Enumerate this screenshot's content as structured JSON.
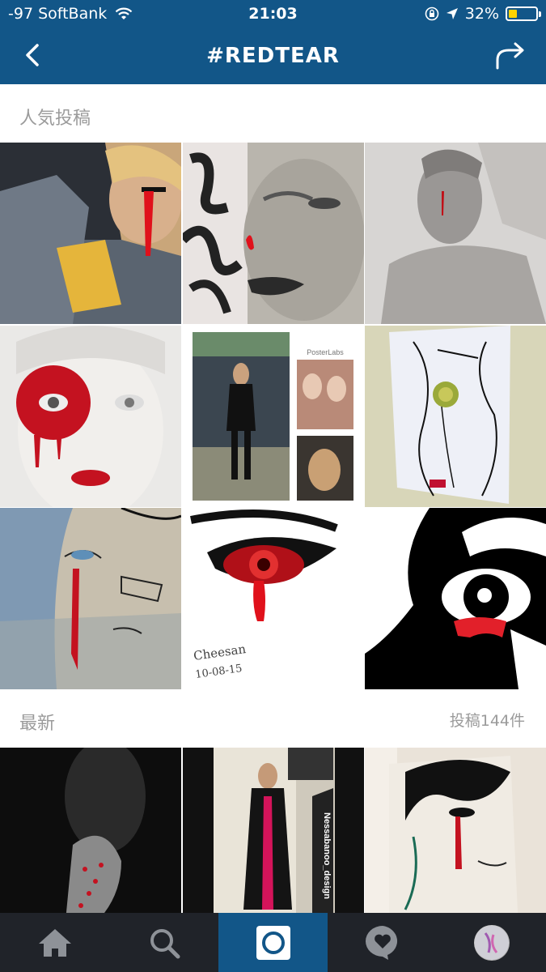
{
  "status_bar": {
    "carrier": "-97 SoftBank",
    "time": "21:03",
    "battery_percent": "32%",
    "battery_level": 0.32,
    "wifi_icon": "wifi-icon",
    "lock_icon": "rotation-lock-icon",
    "location_icon": "location-arrow-icon"
  },
  "nav": {
    "title": "#REDTEAR",
    "back_icon": "chevron-left-icon",
    "share_icon": "share-arrow-icon"
  },
  "sections": {
    "popular_label": "人気投稿",
    "recent_label": "最新",
    "post_count": "投稿144件"
  },
  "tiles": {
    "popular_tile_5": {
      "caption": "PosterLabs"
    },
    "popular_tile_8": {
      "signature": "Cheesan",
      "date": "10-08-15"
    },
    "recent_tile_2": {
      "caption": "Nessabanoo_design"
    }
  },
  "tabs": [
    {
      "name": "home",
      "icon": "home-icon"
    },
    {
      "name": "search",
      "icon": "search-icon"
    },
    {
      "name": "camera",
      "icon": "camera-icon"
    },
    {
      "name": "activity",
      "icon": "heart-bubble-icon"
    },
    {
      "name": "profile",
      "icon": "avatar"
    }
  ],
  "colors": {
    "brand_blue": "#125688",
    "tab_bar_bg": "#202329",
    "battery_yellow": "#ffd400",
    "section_text": "#9b9b9b",
    "accent_red": "#cc1a1a"
  }
}
